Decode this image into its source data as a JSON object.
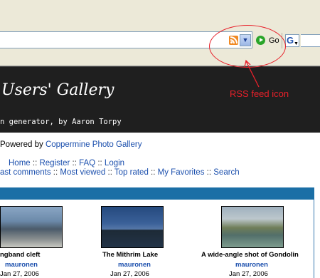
{
  "browser": {
    "go_label": "Go",
    "icons": [
      "rss-feed-icon",
      "dropdown-arrow-icon",
      "go-icon",
      "search-engine-icon"
    ]
  },
  "annotation": {
    "label": "RSS feed icon",
    "color": "#e8202a"
  },
  "header": {
    "title": "Users' Gallery",
    "subtitle": "n generator, by Aaron Torpy"
  },
  "page": {
    "powered_prefix": "Powered by ",
    "powered_link": "Coppermine Photo Gallery",
    "top_nav": [
      "Home",
      "Register",
      "FAQ",
      "Login"
    ],
    "sub_nav": [
      "ast comments",
      "Most viewed",
      "Top rated",
      "My Favorites",
      "Search"
    ],
    "separator": "::"
  },
  "gallery": {
    "header_color": "#1b6fa6",
    "items": [
      {
        "title": "ngband cleft",
        "user": "mauronen",
        "date": "Jan 27, 2006"
      },
      {
        "title": "The Mithrim Lake",
        "user": "mauronen",
        "date": "Jan 27, 2006"
      },
      {
        "title": "A wide-angle shot of Gondolin",
        "user": "mauronen",
        "date": "Jan 27, 2006"
      }
    ]
  }
}
